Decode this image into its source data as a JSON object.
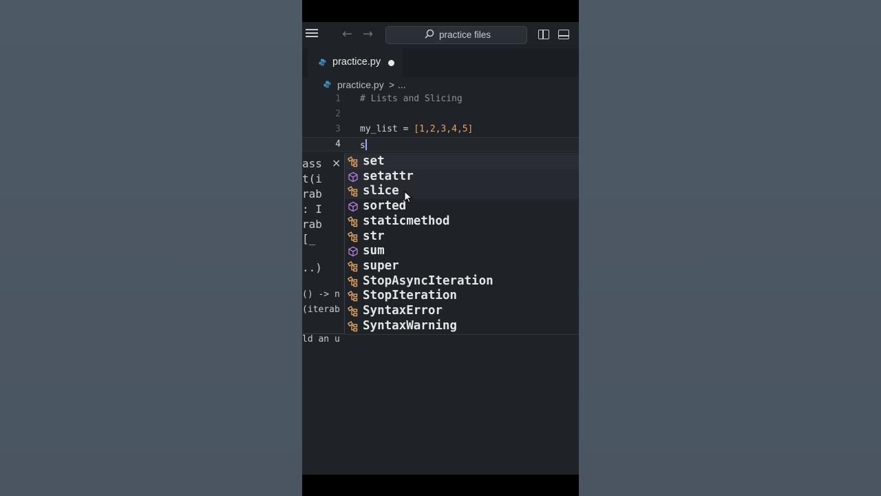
{
  "titlebar": {
    "search_placeholder": "practice files"
  },
  "tabs": [
    {
      "label": "practice.py",
      "dirty": true
    }
  ],
  "breadcrumb": {
    "file": "practice.py",
    "separator": ">",
    "more": "..."
  },
  "editor": {
    "lines": [
      {
        "number": "1",
        "text": "# Lists and Slicing"
      },
      {
        "number": "2",
        "text": ""
      },
      {
        "number": "3",
        "var": "my_list",
        "op": " = ",
        "value": "[1,2,3,4,5]"
      },
      {
        "number": "4",
        "text": "s"
      }
    ]
  },
  "hover_doc": {
    "fragments": [
      "ass",
      "t(i",
      "rab",
      ": I",
      "rab",
      "[_",
      "..)",
      "() -> n",
      "(iterab",
      "ld an u"
    ],
    "close_glyph": "×"
  },
  "suggestions": [
    {
      "label": "set",
      "kind": "class"
    },
    {
      "label": "setattr",
      "kind": "function"
    },
    {
      "label": "slice",
      "kind": "class"
    },
    {
      "label": "sorted",
      "kind": "function"
    },
    {
      "label": "staticmethod",
      "kind": "class"
    },
    {
      "label": "str",
      "kind": "class"
    },
    {
      "label": "sum",
      "kind": "function"
    },
    {
      "label": "super",
      "kind": "class"
    },
    {
      "label": "StopAsyncIteration",
      "kind": "class"
    },
    {
      "label": "StopIteration",
      "kind": "class"
    },
    {
      "label": "SyntaxError",
      "kind": "class"
    },
    {
      "label": "SyntaxWarning",
      "kind": "class"
    }
  ],
  "colors": {
    "class_icon": "#e8a35d",
    "function_icon": "#b180d7",
    "python_icon": "#3d8fc4"
  }
}
